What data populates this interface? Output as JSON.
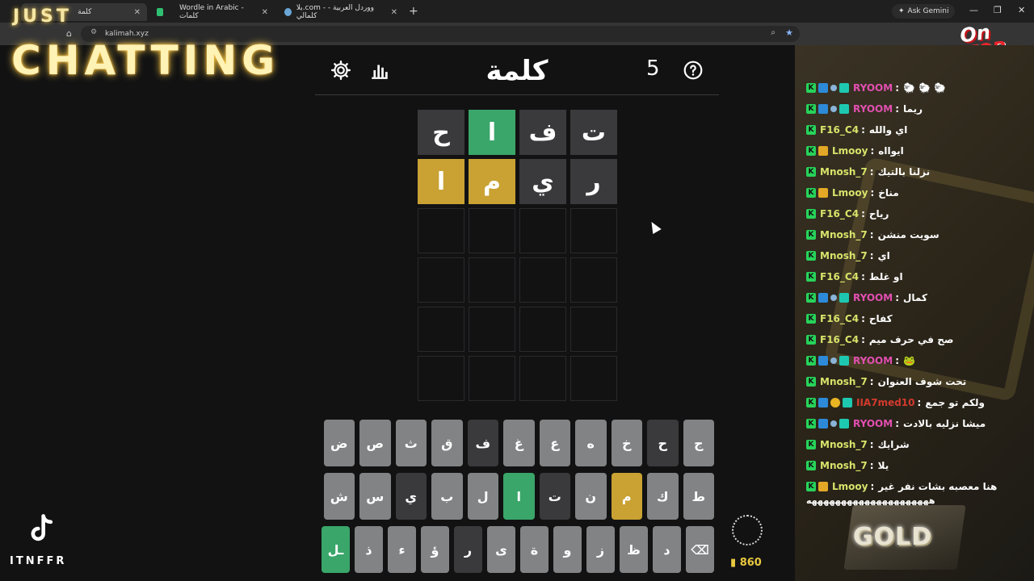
{
  "browser": {
    "tabs": [
      {
        "title": "كلمة",
        "favicon_color": "#3a3a3c"
      },
      {
        "title": "",
        "favicon_color": "#2fbf71"
      },
      {
        "title": "Wordle in Arabic - كلمات",
        "favicon_color": "#2b2b2b"
      },
      {
        "title": "بلا.com - ووردل العربية - كلمالي",
        "favicon_color": "#6aa6d6"
      }
    ],
    "new_tab": "+",
    "url": "kalimah.xyz",
    "gemini_label": "Ask Gemini",
    "win_min": "—",
    "win_max": "❐",
    "win_close": "✕"
  },
  "overlay": {
    "just": "JUST",
    "chatting": "CHATTING",
    "on": "On",
    "top": "TOP",
    "handle": "ITNFFR",
    "points": "860"
  },
  "game": {
    "title": "كلمة",
    "streak": "5",
    "settings_icon": "gear-icon",
    "stats_icon": "bar-chart-icon",
    "help_icon": "question-icon",
    "rows": [
      [
        {
          "l": "ت",
          "s": "absent"
        },
        {
          "l": "ف",
          "s": "absent"
        },
        {
          "l": "ا",
          "s": "correct"
        },
        {
          "l": "ح",
          "s": "absent"
        }
      ],
      [
        {
          "l": "ر",
          "s": "absent"
        },
        {
          "l": "ي",
          "s": "absent"
        },
        {
          "l": "م",
          "s": "present"
        },
        {
          "l": "ا",
          "s": "present"
        }
      ],
      [
        {
          "l": "",
          "s": "empty"
        },
        {
          "l": "",
          "s": "empty"
        },
        {
          "l": "",
          "s": "empty"
        },
        {
          "l": "",
          "s": "empty"
        }
      ],
      [
        {
          "l": "",
          "s": "empty"
        },
        {
          "l": "",
          "s": "empty"
        },
        {
          "l": "",
          "s": "empty"
        },
        {
          "l": "",
          "s": "empty"
        }
      ],
      [
        {
          "l": "",
          "s": "empty"
        },
        {
          "l": "",
          "s": "empty"
        },
        {
          "l": "",
          "s": "empty"
        },
        {
          "l": "",
          "s": "empty"
        }
      ],
      [
        {
          "l": "",
          "s": "empty"
        },
        {
          "l": "",
          "s": "empty"
        },
        {
          "l": "",
          "s": "empty"
        },
        {
          "l": "",
          "s": "empty"
        }
      ]
    ],
    "keyboard": [
      [
        {
          "k": "ج",
          "s": ""
        },
        {
          "k": "ح",
          "s": "absent"
        },
        {
          "k": "خ",
          "s": ""
        },
        {
          "k": "ه",
          "s": ""
        },
        {
          "k": "ع",
          "s": ""
        },
        {
          "k": "غ",
          "s": ""
        },
        {
          "k": "ف",
          "s": "absent"
        },
        {
          "k": "ق",
          "s": ""
        },
        {
          "k": "ث",
          "s": ""
        },
        {
          "k": "ص",
          "s": ""
        },
        {
          "k": "ض",
          "s": ""
        }
      ],
      [
        {
          "k": "ط",
          "s": ""
        },
        {
          "k": "ك",
          "s": ""
        },
        {
          "k": "م",
          "s": "present"
        },
        {
          "k": "ن",
          "s": ""
        },
        {
          "k": "ت",
          "s": "absent"
        },
        {
          "k": "ا",
          "s": "correct"
        },
        {
          "k": "ل",
          "s": ""
        },
        {
          "k": "ب",
          "s": ""
        },
        {
          "k": "ي",
          "s": "absent"
        },
        {
          "k": "س",
          "s": ""
        },
        {
          "k": "ش",
          "s": ""
        }
      ],
      [
        {
          "k": "⌫",
          "s": ""
        },
        {
          "k": "د",
          "s": ""
        },
        {
          "k": "ظ",
          "s": ""
        },
        {
          "k": "ز",
          "s": ""
        },
        {
          "k": "و",
          "s": ""
        },
        {
          "k": "ة",
          "s": ""
        },
        {
          "k": "ى",
          "s": ""
        },
        {
          "k": "ر",
          "s": "absent"
        },
        {
          "k": "ؤ",
          "s": ""
        },
        {
          "k": "ء",
          "s": ""
        },
        {
          "k": "ذ",
          "s": ""
        },
        {
          "k": "ـل",
          "s": "correct"
        }
      ]
    ]
  },
  "chat": {
    "messages": [
      {
        "badges": [
          "k",
          "p",
          "c",
          "g"
        ],
        "user": "RYOOM",
        "color": "#e24fb0",
        "text": "🐑 🐑 🐑"
      },
      {
        "badges": [
          "k",
          "p",
          "c",
          "g"
        ],
        "user": "RYOOM",
        "color": "#e24fb0",
        "text": "ريما"
      },
      {
        "badges": [
          "k"
        ],
        "user": "F16_C4",
        "color": "#d7e36a",
        "text": "اي والله"
      },
      {
        "badges": [
          "k",
          "cr"
        ],
        "user": "Lmooy",
        "color": "#d7e36a",
        "text": "ايوااه"
      },
      {
        "badges": [
          "k"
        ],
        "user": "Mnosh_7",
        "color": "#d7e36a",
        "text": "نزلنا بالتيك"
      },
      {
        "badges": [
          "k",
          "cr"
        ],
        "user": "Lmooy",
        "color": "#d7e36a",
        "text": "مناخ"
      },
      {
        "badges": [
          "k"
        ],
        "user": "F16_C4",
        "color": "#d7e36a",
        "text": "رياح"
      },
      {
        "badges": [
          "k"
        ],
        "user": "Mnosh_7",
        "color": "#d7e36a",
        "text": "سويت منشن"
      },
      {
        "badges": [
          "k"
        ],
        "user": "Mnosh_7",
        "color": "#d7e36a",
        "text": "اي"
      },
      {
        "badges": [
          "k"
        ],
        "user": "F16_C4",
        "color": "#d7e36a",
        "text": "او غلط"
      },
      {
        "badges": [
          "k",
          "p",
          "c",
          "g"
        ],
        "user": "RYOOM",
        "color": "#e24fb0",
        "text": "كمال"
      },
      {
        "badges": [
          "k"
        ],
        "user": "F16_C4",
        "color": "#d7e36a",
        "text": "كفاح"
      },
      {
        "badges": [
          "k"
        ],
        "user": "F16_C4",
        "color": "#d7e36a",
        "text": "صح في حرف ميم"
      },
      {
        "badges": [
          "k",
          "p",
          "c",
          "g"
        ],
        "user": "RYOOM",
        "color": "#e24fb0",
        "text": "🐸"
      },
      {
        "badges": [
          "k"
        ],
        "user": "Mnosh_7",
        "color": "#d7e36a",
        "text": "تحت شوف العنوان"
      },
      {
        "badges": [
          "k",
          "p",
          "o",
          "g"
        ],
        "user": "IIA7med10",
        "color": "#d43a2e",
        "text": "ولكم تو جمع"
      },
      {
        "badges": [
          "k",
          "p",
          "c",
          "g"
        ],
        "user": "RYOOM",
        "color": "#e24fb0",
        "text": "ميشا نزليه بالادت"
      },
      {
        "badges": [
          "k"
        ],
        "user": "Mnosh_7",
        "color": "#d7e36a",
        "text": "شرايك"
      },
      {
        "badges": [
          "k"
        ],
        "user": "Mnosh_7",
        "color": "#d7e36a",
        "text": "يلا"
      },
      {
        "badges": [
          "k",
          "cr"
        ],
        "user": "Lmooy",
        "color": "#d7e36a",
        "text": "هنا معصبه بشات نفر غير"
      }
    ],
    "trailing_text": "هههههههههههههههههههههه",
    "gold_label": "GOLD"
  }
}
